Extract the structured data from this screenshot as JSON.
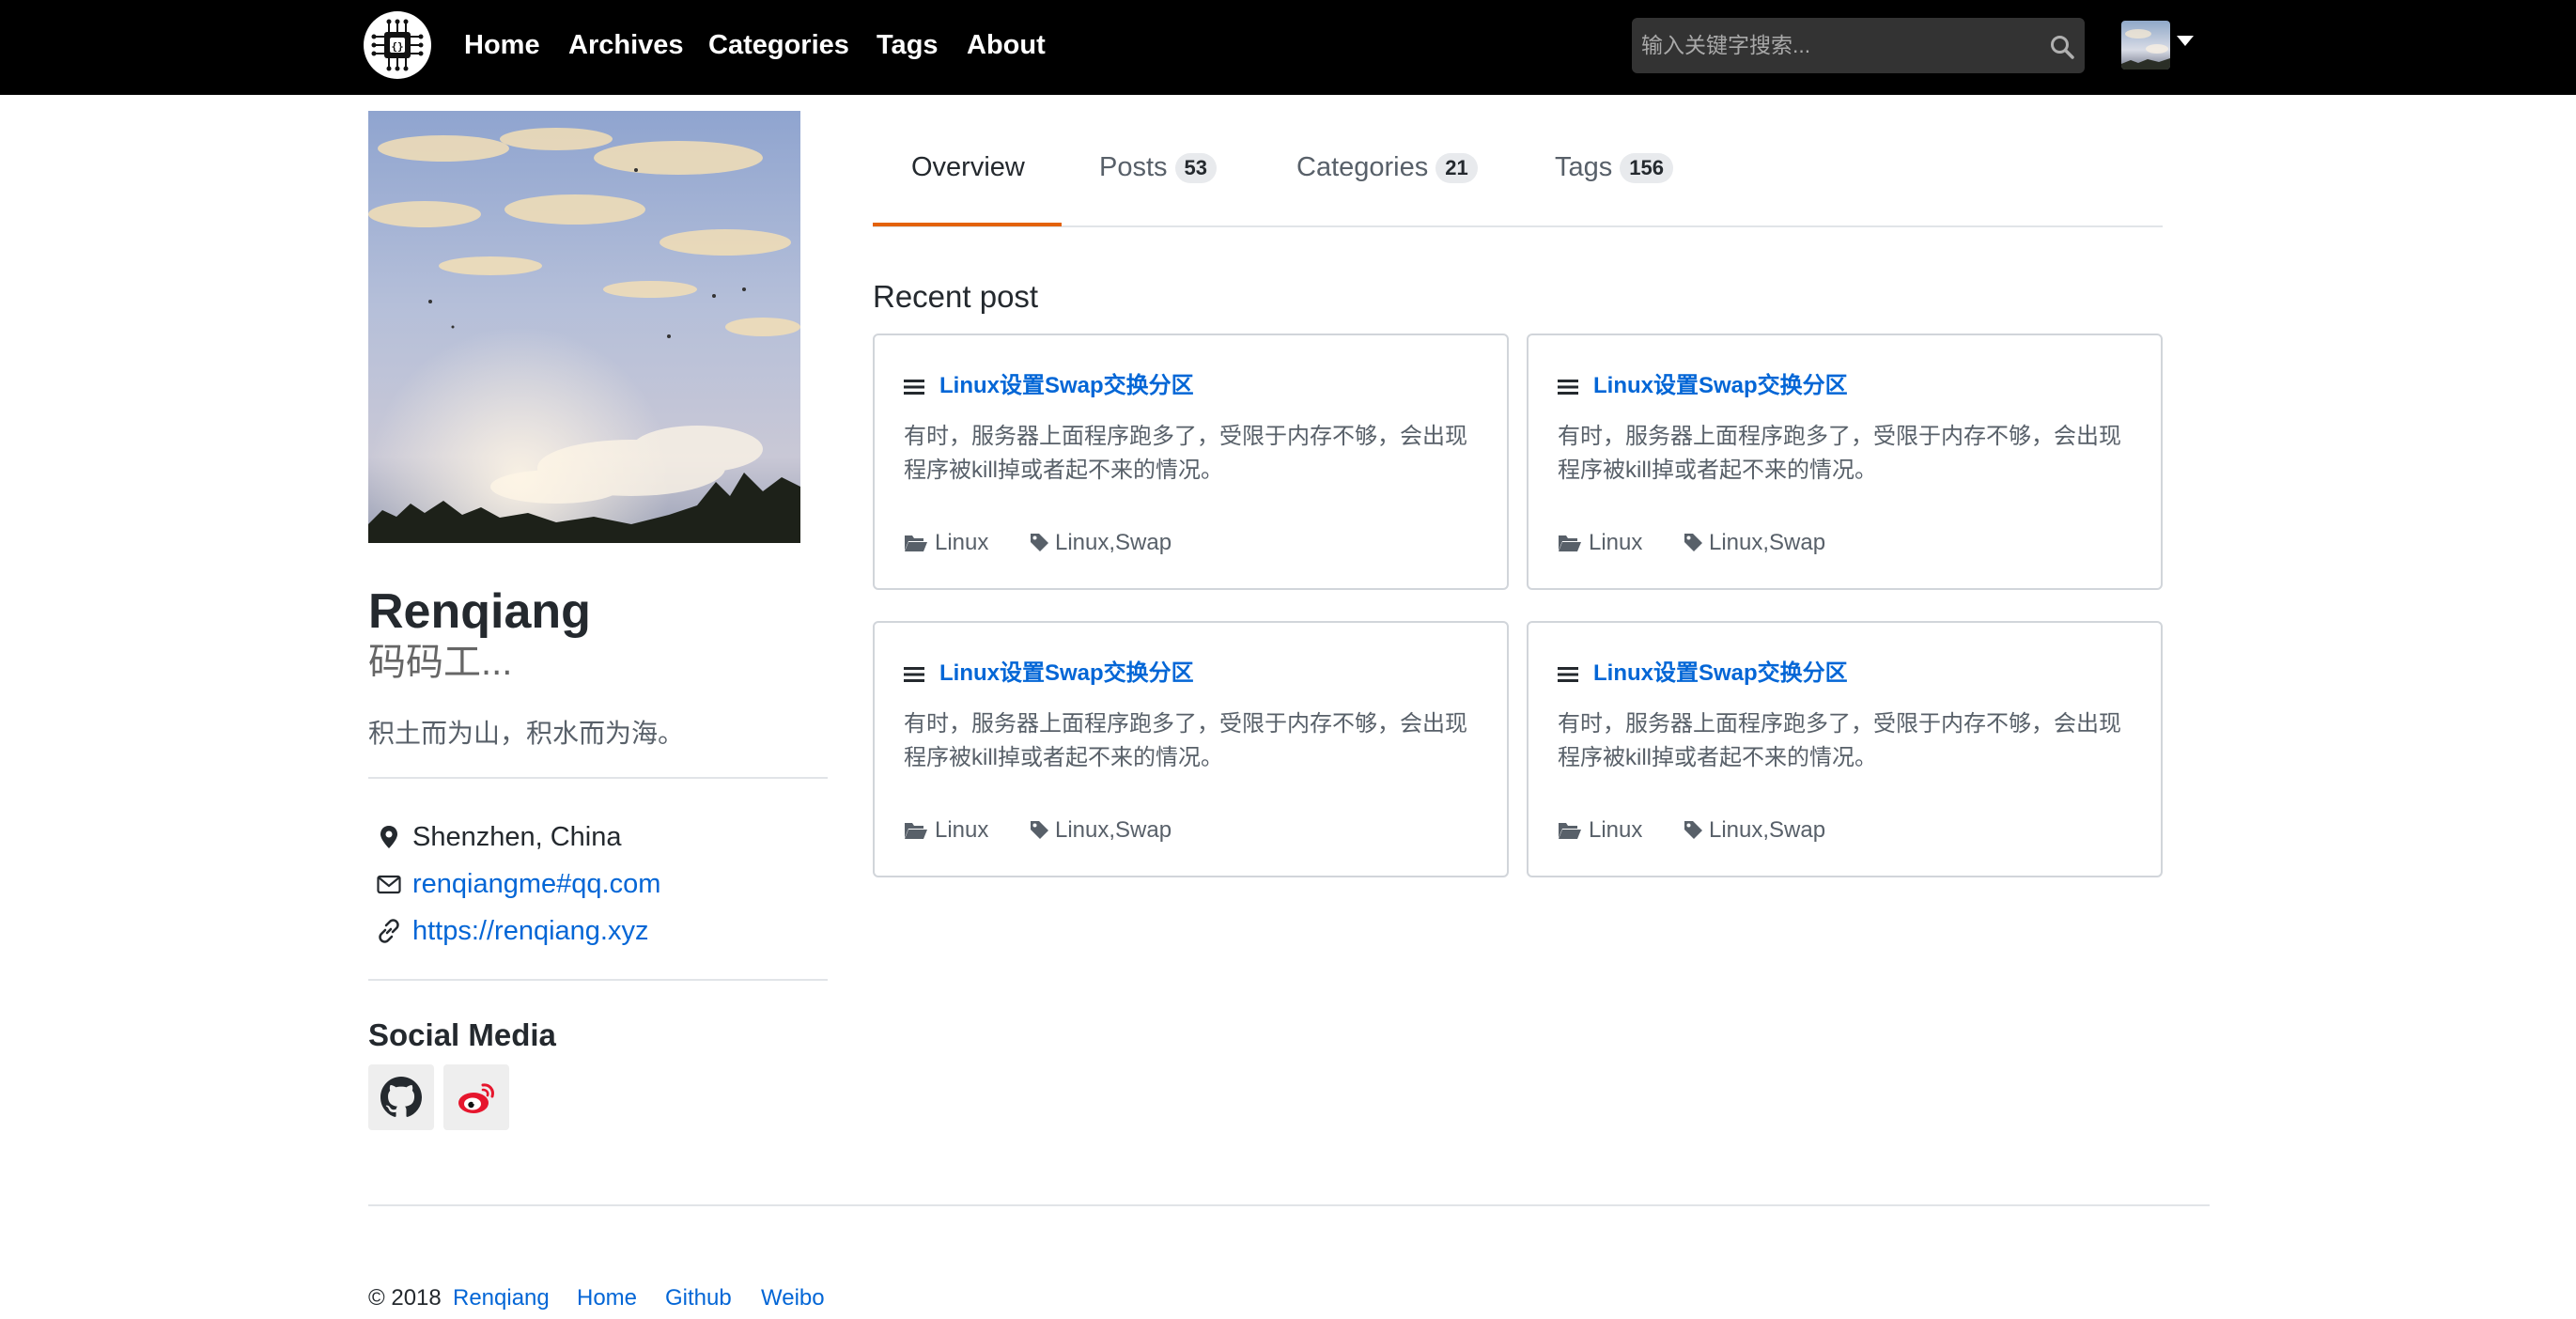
{
  "nav": {
    "links": [
      "Home",
      "Archives",
      "Categories",
      "Tags",
      "About"
    ],
    "search_placeholder": "输入关键字搜索..."
  },
  "profile": {
    "name": "Renqiang",
    "nickname": "码码工...",
    "bio": "积土而为山，积水而为海。",
    "location": "Shenzhen, China",
    "email": "renqiangme#qq.com",
    "website": "https://renqiang.xyz",
    "social_title": "Social Media",
    "social": [
      "github-icon",
      "weibo-icon"
    ]
  },
  "tabs": [
    {
      "label": "Overview",
      "count": null,
      "active": true
    },
    {
      "label": "Posts",
      "count": "53"
    },
    {
      "label": "Categories",
      "count": "21"
    },
    {
      "label": "Tags",
      "count": "156"
    }
  ],
  "recent": {
    "title": "Recent post",
    "posts": [
      {
        "title": "Linux设置Swap交换分区",
        "desc": "有时，服务器上面程序跑多了，受限于内存不够，会出现程序被kill掉或者起不来的情况。",
        "category": "Linux",
        "tags": "Linux,Swap"
      },
      {
        "title": "Linux设置Swap交换分区",
        "desc": "有时，服务器上面程序跑多了，受限于内存不够，会出现程序被kill掉或者起不来的情况。",
        "category": "Linux",
        "tags": "Linux,Swap"
      },
      {
        "title": "Linux设置Swap交换分区",
        "desc": "有时，服务器上面程序跑多了，受限于内存不够，会出现程序被kill掉或者起不来的情况。",
        "category": "Linux",
        "tags": "Linux,Swap"
      },
      {
        "title": "Linux设置Swap交换分区",
        "desc": "有时，服务器上面程序跑多了，受限于内存不够，会出现程序被kill掉或者起不来的情况。",
        "category": "Linux",
        "tags": "Linux,Swap"
      }
    ]
  },
  "footer": {
    "copyright": "© 2018",
    "links": [
      "Renqiang",
      "Home",
      "Github",
      "Weibo"
    ]
  },
  "colors": {
    "navbar_bg": "#000000",
    "link": "#0366d6",
    "active_tab_accent": "#e36209",
    "weibo_red": "#e6162d"
  }
}
